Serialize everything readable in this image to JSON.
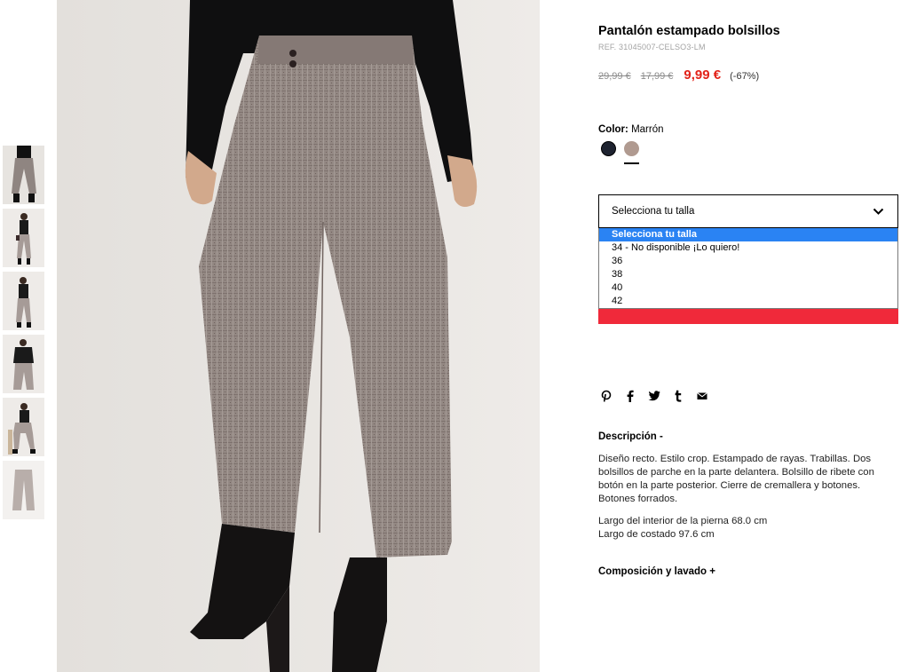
{
  "thumbnails": [
    {
      "alt": "thumb-1"
    },
    {
      "alt": "thumb-2"
    },
    {
      "alt": "thumb-3"
    },
    {
      "alt": "thumb-4"
    },
    {
      "alt": "thumb-5"
    },
    {
      "alt": "thumb-6"
    }
  ],
  "product": {
    "title": "Pantalón estampado bolsillos",
    "ref": "REF. 31045007-CELSO3-LM",
    "price_original": "29,99 €",
    "price_previous": "17,99 €",
    "price_sale": "9,99 €",
    "discount": "(-67%)"
  },
  "color": {
    "label": "Color:",
    "value": "Marrón",
    "swatches": [
      "navy",
      "brown"
    ],
    "selected": "brown"
  },
  "size_select": {
    "label": "Selecciona tu talla",
    "options": [
      "Selecciona tu talla",
      "34 - No disponible ¡Lo quiero!",
      "36",
      "38",
      "40",
      "42"
    ],
    "highlighted_index": 0
  },
  "share": [
    "pinterest-icon",
    "facebook-icon",
    "twitter-icon",
    "tumblr-icon",
    "email-icon"
  ],
  "description": {
    "heading": "Descripción  -",
    "text": "Diseño recto. Estilo crop. Estampado de rayas. Trabillas. Dos bolsillos de parche en la parte delantera. Bolsillo de ribete con botón en la parte posterior. Cierre de cremallera y botones. Botones forrados.",
    "measure_1": "Largo del interior de la pierna 68.0 cm",
    "measure_2": "Largo de costado 97.6 cm"
  },
  "composition": {
    "heading": "Composición y lavado  +"
  },
  "colors": {
    "sale_red": "#e2231a",
    "cta_red": "#f0293a",
    "select_blue": "#2a83f3"
  }
}
